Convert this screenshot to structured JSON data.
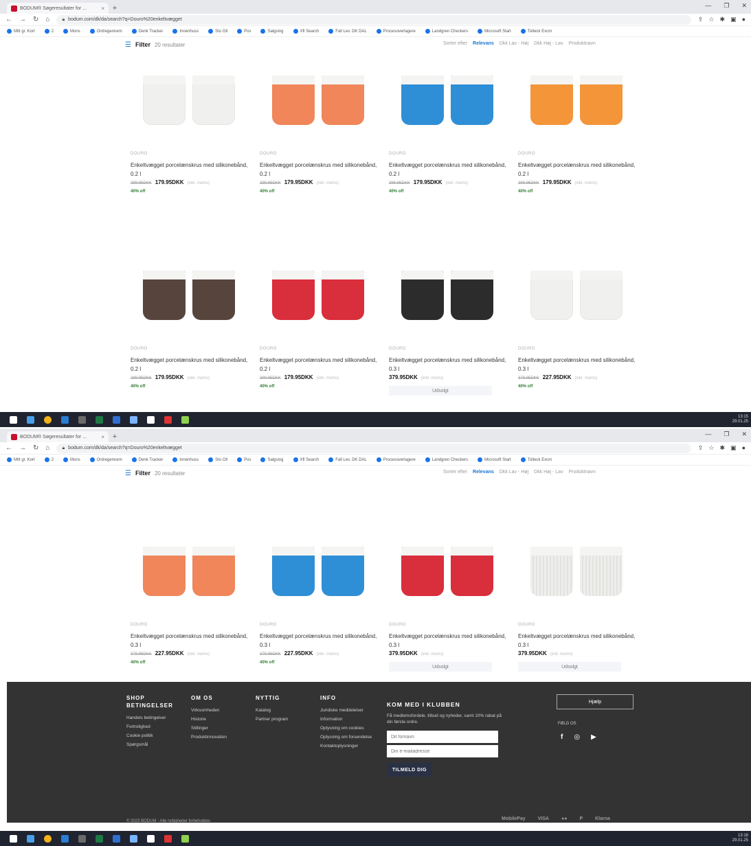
{
  "browser": {
    "tab_title": "BODUM® Søgeresultater for ...",
    "url": "bodum.com/dk/da/search?q=Douro%20enkeltvægget",
    "bookmarks": [
      "Mitt gr. Kort",
      "2",
      "Mons",
      "Ordregennem",
      "Denk Tracker",
      "Innenhuss",
      "Sto Oll",
      "Pos",
      "Salgsing",
      "Xfl Search",
      "Fall Lev. DK DAL",
      "Procesoverlagere",
      "Landgren Checkers",
      "Microsoft Start",
      "Tolteck Excm"
    ]
  },
  "colors": {
    "accent": "#1976d2",
    "discount": "#2e7d32",
    "footer_bg": "#333333",
    "orange": "#f0865a",
    "blue": "#2f8fd6",
    "bright_orange": "#f39538",
    "brown": "#57453d",
    "red": "#d92e3b",
    "black": "#2c2c2c",
    "white": "#f0f0ee"
  },
  "filterbar": {
    "label": "Filter",
    "count": "20 resultater",
    "sort_label": "Sorter efter",
    "sort_options": [
      "Relevans",
      "Dkk Lav - Høj",
      "Dkk Høj - Lav",
      "Produktnavn"
    ]
  },
  "page1": {
    "products": [
      {
        "brand": "DOURO",
        "name": "Enkeltvægget porcelænskrus med silikonebånd, 0.2 l",
        "old_price": "299.95DKK",
        "price": "179.95DKK",
        "vat": "(inkl. moms)",
        "discount": "40% off",
        "soldout": "",
        "mug_color": "white"
      },
      {
        "brand": "DOURO",
        "name": "Enkeltvægget porcelænskrus med silikonebånd, 0.2 l",
        "old_price": "299.95DKK",
        "price": "179.95DKK",
        "vat": "(inkl. moms)",
        "discount": "40% off",
        "soldout": "",
        "mug_color": "orange"
      },
      {
        "brand": "DOURO",
        "name": "Enkeltvægget porcelænskrus med silikonebånd, 0.2 l",
        "old_price": "299.95DKK",
        "price": "179.95DKK",
        "vat": "(inkl. moms)",
        "discount": "40% off",
        "soldout": "",
        "mug_color": "blue"
      },
      {
        "brand": "DOURO",
        "name": "Enkeltvægget porcelænskrus med silikonebånd, 0.2 l",
        "old_price": "299.95DKK",
        "price": "179.95DKK",
        "vat": "(inkl. moms)",
        "discount": "40% off",
        "soldout": "",
        "mug_color": "bright_orange"
      },
      {
        "brand": "DOURO",
        "name": "Enkeltvægget porcelænskrus med silikonebånd, 0.2 l",
        "old_price": "299.95DKK",
        "price": "179.95DKK",
        "vat": "(inkl. moms)",
        "discount": "40% off",
        "soldout": "",
        "mug_color": "brown"
      },
      {
        "brand": "DOURO",
        "name": "Enkeltvægget porcelænskrus med silikonebånd, 0.2 l",
        "old_price": "299.95DKK",
        "price": "179.95DKK",
        "vat": "(inkl. moms)",
        "discount": "40% off",
        "soldout": "",
        "mug_color": "red"
      },
      {
        "brand": "DOURO",
        "name": "Enkeltvægget porcelænskrus med silikonebånd, 0.3 l",
        "old_price": "",
        "price": "379.95DKK",
        "vat": "(inkl. moms)",
        "discount": "",
        "soldout": "Udsolgt",
        "mug_color": "black"
      },
      {
        "brand": "DOURO",
        "name": "Enkeltvægget porcelænskrus med silikonebånd, 0.3 l",
        "old_price": "379.95DKK",
        "price": "227.95DKK",
        "vat": "(inkl. moms)",
        "discount": "40% off",
        "soldout": "",
        "mug_color": "white"
      }
    ]
  },
  "page2": {
    "products": [
      {
        "brand": "DOURO",
        "name": "Enkeltvægget porcelænskrus med silikonebånd, 0.3 l",
        "old_price": "379.95DKK",
        "price": "227.95DKK",
        "vat": "(inkl. moms)",
        "discount": "40% off",
        "soldout": "",
        "mug_color": "orange"
      },
      {
        "brand": "DOURO",
        "name": "Enkeltvægget porcelænskrus med silikonebånd, 0.3 l",
        "old_price": "379.95DKK",
        "price": "227.95DKK",
        "vat": "(inkl. moms)",
        "discount": "40% off",
        "soldout": "",
        "mug_color": "blue"
      },
      {
        "brand": "DOURO",
        "name": "Enkeltvægget porcelænskrus med silikonebånd, 0.3 l",
        "old_price": "",
        "price": "379.95DKK",
        "vat": "(inkl. moms)",
        "discount": "",
        "soldout": "Udsolgt",
        "mug_color": "red"
      },
      {
        "brand": "DOURO",
        "name": "Enkeltvægget porcelænskrus med silikonebånd, 0.3 l",
        "old_price": "",
        "price": "379.95DKK",
        "vat": "(inkl. moms)",
        "discount": "",
        "soldout": "Udsolgt",
        "mug_color": "white_ribbed"
      }
    ]
  },
  "footer": {
    "columns": [
      {
        "title": "SHOP BETINGELSER",
        "links": [
          "Handels betingelser",
          "Fortrolighed",
          "Cookie politik",
          "Spørgsmål"
        ]
      },
      {
        "title": "OM OS",
        "links": [
          "Virksomheden",
          "Historie",
          "Stillinger",
          "Produktinnovation"
        ]
      },
      {
        "title": "NYTTIG",
        "links": [
          "Katalog",
          "Partner program"
        ]
      },
      {
        "title": "INFO",
        "links": [
          "Juridiske meddelelser",
          "Information",
          "Oplysning om cookies",
          "Oplysning om forsendelse",
          "Kontaktoplysninger"
        ]
      }
    ],
    "club": {
      "title": "KOM MED I KLUBBEN",
      "text": "Få medlemsfordele, tilbud og nyheder, samt 10% rabat på din første ordre.",
      "name_placeholder": "Dit fornavn",
      "email_placeholder": "Din e-mailadresse",
      "button": "TILMELD DIG"
    },
    "help": "Hjælp",
    "follow": "FØLG OS",
    "socials": [
      "f",
      "◎",
      "▶"
    ],
    "copyright": "© 2023 BODUM · Alle rettigheder forbeholdes",
    "payments": [
      "MobilePay",
      "VISA",
      "●●",
      "P",
      "Klarna"
    ]
  },
  "taskbar": {
    "time1": "13:15",
    "date1": "29.01.25",
    "time2": "13:16",
    "date2": "29.01.25"
  }
}
